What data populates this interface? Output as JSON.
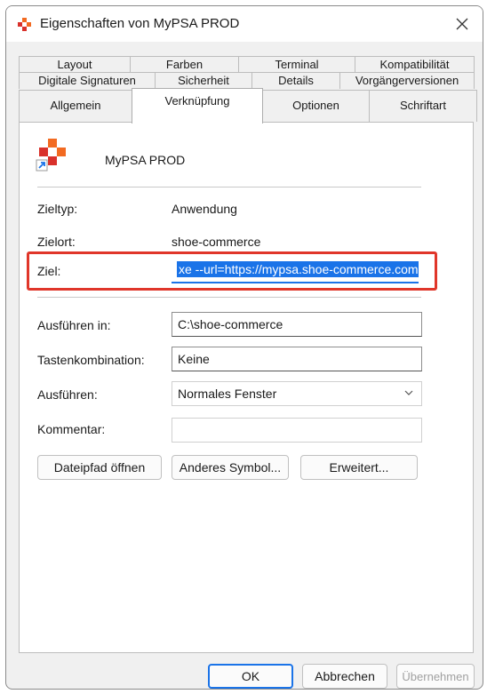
{
  "window": {
    "title": "Eigenschaften von MyPSA PROD"
  },
  "tabs": {
    "row1": [
      "Layout",
      "Farben",
      "Terminal",
      "Kompatibilität"
    ],
    "row2": [
      "Digitale Signaturen",
      "Sicherheit",
      "Details",
      "Vorgängerversionen"
    ],
    "row3": [
      "Allgemein",
      "Verknüpfung",
      "Optionen",
      "Schriftart"
    ],
    "active": "Verknüpfung"
  },
  "shortcut": {
    "name": "MyPSA PROD",
    "zieltyp_label": "Zieltyp:",
    "zieltyp_value": "Anwendung",
    "zielort_label": "Zielort:",
    "zielort_value": "shoe-commerce",
    "ziel_label": "Ziel:",
    "ziel_value": "xe --url=https://mypsa.shoe-commerce.com",
    "ausfuehren_in_label": "Ausführen in:",
    "ausfuehren_in_value": "C:\\shoe-commerce",
    "tastenkombination_label": "Tastenkombination:",
    "tastenkombination_value": "Keine",
    "ausfuehren_label": "Ausführen:",
    "ausfuehren_value": "Normales Fenster",
    "kommentar_label": "Kommentar:",
    "kommentar_value": ""
  },
  "buttons": {
    "open_path": "Dateipfad öffnen",
    "change_icon": "Anderes Symbol...",
    "advanced": "Erweitert...",
    "ok": "OK",
    "cancel": "Abbrechen",
    "apply": "Übernehmen"
  },
  "colors": {
    "highlight_border": "#e0362a",
    "accent": "#1a73e8",
    "icon_orange": "#f26a21",
    "icon_red": "#d9312b"
  }
}
